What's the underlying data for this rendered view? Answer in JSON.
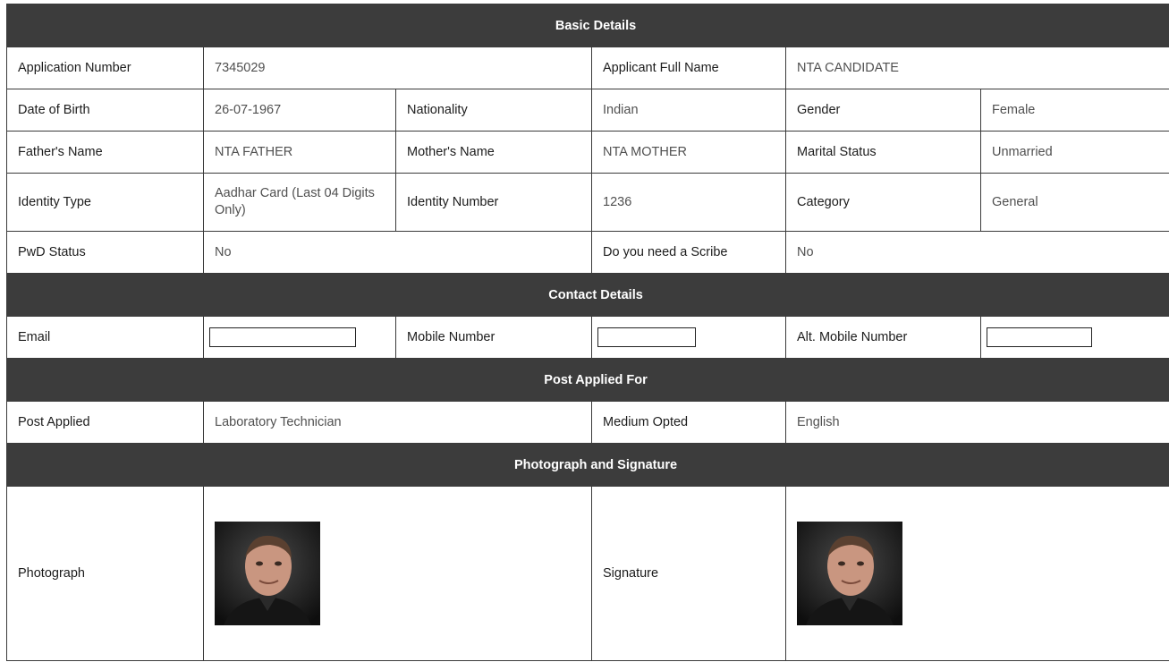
{
  "sections": {
    "basic": "Basic Details",
    "contact": "Contact Details",
    "post": "Post Applied For",
    "photo": "Photograph and Signature"
  },
  "basic": {
    "application_number_label": "Application Number",
    "application_number": "7345029",
    "full_name_label": "Applicant Full Name",
    "full_name": "NTA CANDIDATE",
    "dob_label": "Date of Birth",
    "dob": "26-07-1967",
    "nationality_label": "Nationality",
    "nationality": "Indian",
    "gender_label": "Gender",
    "gender": "Female",
    "father_label": "Father's Name",
    "father": "NTA FATHER",
    "mother_label": "Mother's Name",
    "mother": "NTA MOTHER",
    "marital_label": "Marital Status",
    "marital": "Unmarried",
    "identity_type_label": "Identity Type",
    "identity_type": "Aadhar Card (Last 04 Digits Only)",
    "identity_number_label": "Identity Number",
    "identity_number": "1236",
    "category_label": "Category",
    "category": "General",
    "pwd_label": "PwD Status",
    "pwd": "No",
    "scribe_label": "Do you need a Scribe",
    "scribe": "No"
  },
  "contact": {
    "email_label": "Email",
    "email": "",
    "mobile_label": "Mobile Number",
    "mobile": "",
    "alt_mobile_label": "Alt. Mobile Number",
    "alt_mobile": ""
  },
  "post": {
    "post_label": "Post Applied",
    "post": "Laboratory Technician",
    "medium_label": "Medium Opted",
    "medium": "English"
  },
  "media": {
    "photograph_label": "Photograph",
    "signature_label": "Signature"
  }
}
